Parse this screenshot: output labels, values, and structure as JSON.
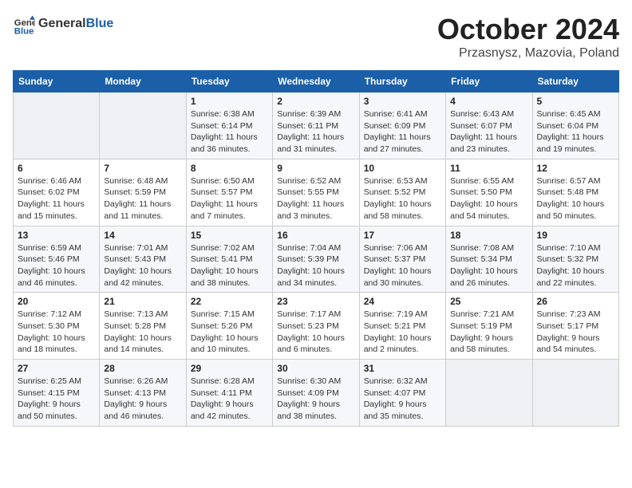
{
  "header": {
    "logo_general": "General",
    "logo_blue": "Blue",
    "title": "October 2024",
    "location": "Przasnysz, Mazovia, Poland"
  },
  "weekdays": [
    "Sunday",
    "Monday",
    "Tuesday",
    "Wednesday",
    "Thursday",
    "Friday",
    "Saturday"
  ],
  "weeks": [
    [
      {
        "day": "",
        "empty": true
      },
      {
        "day": "",
        "empty": true
      },
      {
        "day": "1",
        "sunrise": "6:38 AM",
        "sunset": "6:14 PM",
        "daylight": "11 hours and 36 minutes."
      },
      {
        "day": "2",
        "sunrise": "6:39 AM",
        "sunset": "6:11 PM",
        "daylight": "11 hours and 31 minutes."
      },
      {
        "day": "3",
        "sunrise": "6:41 AM",
        "sunset": "6:09 PM",
        "daylight": "11 hours and 27 minutes."
      },
      {
        "day": "4",
        "sunrise": "6:43 AM",
        "sunset": "6:07 PM",
        "daylight": "11 hours and 23 minutes."
      },
      {
        "day": "5",
        "sunrise": "6:45 AM",
        "sunset": "6:04 PM",
        "daylight": "11 hours and 19 minutes."
      }
    ],
    [
      {
        "day": "6",
        "sunrise": "6:46 AM",
        "sunset": "6:02 PM",
        "daylight": "11 hours and 15 minutes."
      },
      {
        "day": "7",
        "sunrise": "6:48 AM",
        "sunset": "5:59 PM",
        "daylight": "11 hours and 11 minutes."
      },
      {
        "day": "8",
        "sunrise": "6:50 AM",
        "sunset": "5:57 PM",
        "daylight": "11 hours and 7 minutes."
      },
      {
        "day": "9",
        "sunrise": "6:52 AM",
        "sunset": "5:55 PM",
        "daylight": "11 hours and 3 minutes."
      },
      {
        "day": "10",
        "sunrise": "6:53 AM",
        "sunset": "5:52 PM",
        "daylight": "10 hours and 58 minutes."
      },
      {
        "day": "11",
        "sunrise": "6:55 AM",
        "sunset": "5:50 PM",
        "daylight": "10 hours and 54 minutes."
      },
      {
        "day": "12",
        "sunrise": "6:57 AM",
        "sunset": "5:48 PM",
        "daylight": "10 hours and 50 minutes."
      }
    ],
    [
      {
        "day": "13",
        "sunrise": "6:59 AM",
        "sunset": "5:46 PM",
        "daylight": "10 hours and 46 minutes."
      },
      {
        "day": "14",
        "sunrise": "7:01 AM",
        "sunset": "5:43 PM",
        "daylight": "10 hours and 42 minutes."
      },
      {
        "day": "15",
        "sunrise": "7:02 AM",
        "sunset": "5:41 PM",
        "daylight": "10 hours and 38 minutes."
      },
      {
        "day": "16",
        "sunrise": "7:04 AM",
        "sunset": "5:39 PM",
        "daylight": "10 hours and 34 minutes."
      },
      {
        "day": "17",
        "sunrise": "7:06 AM",
        "sunset": "5:37 PM",
        "daylight": "10 hours and 30 minutes."
      },
      {
        "day": "18",
        "sunrise": "7:08 AM",
        "sunset": "5:34 PM",
        "daylight": "10 hours and 26 minutes."
      },
      {
        "day": "19",
        "sunrise": "7:10 AM",
        "sunset": "5:32 PM",
        "daylight": "10 hours and 22 minutes."
      }
    ],
    [
      {
        "day": "20",
        "sunrise": "7:12 AM",
        "sunset": "5:30 PM",
        "daylight": "10 hours and 18 minutes."
      },
      {
        "day": "21",
        "sunrise": "7:13 AM",
        "sunset": "5:28 PM",
        "daylight": "10 hours and 14 minutes."
      },
      {
        "day": "22",
        "sunrise": "7:15 AM",
        "sunset": "5:26 PM",
        "daylight": "10 hours and 10 minutes."
      },
      {
        "day": "23",
        "sunrise": "7:17 AM",
        "sunset": "5:23 PM",
        "daylight": "10 hours and 6 minutes."
      },
      {
        "day": "24",
        "sunrise": "7:19 AM",
        "sunset": "5:21 PM",
        "daylight": "10 hours and 2 minutes."
      },
      {
        "day": "25",
        "sunrise": "7:21 AM",
        "sunset": "5:19 PM",
        "daylight": "9 hours and 58 minutes."
      },
      {
        "day": "26",
        "sunrise": "7:23 AM",
        "sunset": "5:17 PM",
        "daylight": "9 hours and 54 minutes."
      }
    ],
    [
      {
        "day": "27",
        "sunrise": "6:25 AM",
        "sunset": "4:15 PM",
        "daylight": "9 hours and 50 minutes."
      },
      {
        "day": "28",
        "sunrise": "6:26 AM",
        "sunset": "4:13 PM",
        "daylight": "9 hours and 46 minutes."
      },
      {
        "day": "29",
        "sunrise": "6:28 AM",
        "sunset": "4:11 PM",
        "daylight": "9 hours and 42 minutes."
      },
      {
        "day": "30",
        "sunrise": "6:30 AM",
        "sunset": "4:09 PM",
        "daylight": "9 hours and 38 minutes."
      },
      {
        "day": "31",
        "sunrise": "6:32 AM",
        "sunset": "4:07 PM",
        "daylight": "9 hours and 35 minutes."
      },
      {
        "day": "",
        "empty": true
      },
      {
        "day": "",
        "empty": true
      }
    ]
  ]
}
